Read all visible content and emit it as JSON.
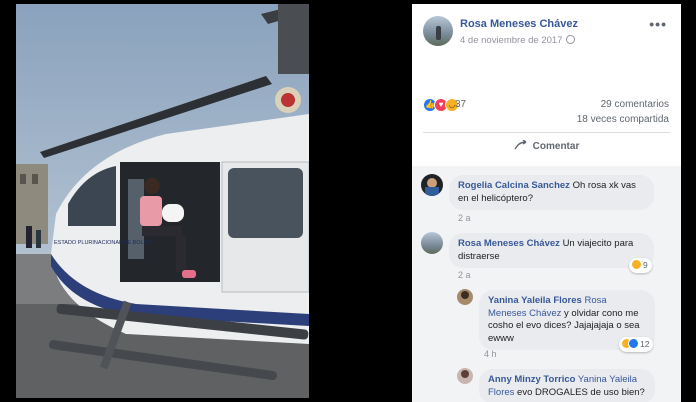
{
  "post": {
    "author": "Rosa Meneses Chávez",
    "date": "4 de noviembre de 2017",
    "more_label": "•••",
    "reactions_count": "37",
    "comments_count": "29 comentarios",
    "shares_count": "18 veces compartida",
    "comment_action": "Comentar",
    "photo_text": "ESTADO PLURINACIONAL DE BOLIVIA"
  },
  "comments": [
    {
      "name": "Rogelia Calcina Sanchez",
      "text": "Oh rosa xk vas en el helicóptero?",
      "time": "2 a",
      "reaction_count": ""
    },
    {
      "name": "Rosa Meneses Chávez",
      "text": "Un viajecito para distraerse",
      "time": "2 a",
      "reaction_count": "9"
    },
    {
      "name": "Yanina Yaleila Flores",
      "mention": "Rosa Meneses Chávez",
      "text": "y olvidar cono me cosho el evo dices? Jajajajaja o sea ewww",
      "time": "4 h",
      "reaction_count": "12"
    },
    {
      "name": "Anny Minzy Torrico",
      "mention": "Yanina Yaleila Flores",
      "text": "evo DROGALES de uso bien?",
      "time": "",
      "reaction_count": ""
    }
  ],
  "colors": {
    "link": "#385898",
    "like": "#2078f4",
    "love": "#f33e58",
    "haha": "#f7b125",
    "bubble": "#e9ebee"
  },
  "icons": [
    "globe-icon",
    "more-icon",
    "comment-icon",
    "like-icon",
    "love-icon",
    "haha-icon"
  ]
}
